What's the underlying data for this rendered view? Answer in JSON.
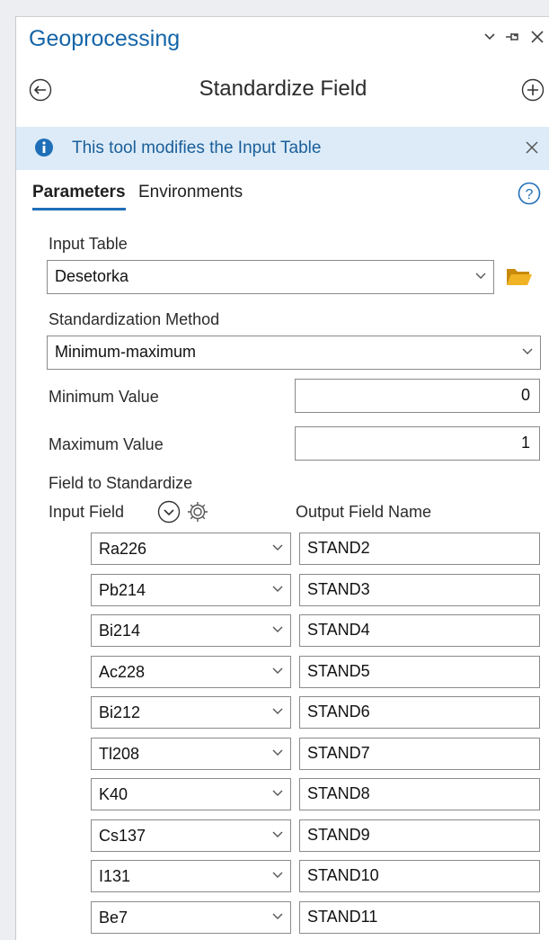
{
  "panel": {
    "title": "Geoprocessing",
    "tool_title": "Standardize Field",
    "info_message": "This tool modifies the Input Table",
    "tabs": [
      "Parameters",
      "Environments"
    ]
  },
  "params": {
    "input_table_label": "Input Table",
    "input_table_value": "Desetorka",
    "method_label": "Standardization Method",
    "method_value": "Minimum-maximum",
    "min_label": "Minimum Value",
    "min_value": "0",
    "max_label": "Maximum Value",
    "max_value": "1",
    "field_label": "Field to Standardize",
    "input_field_header": "Input Field",
    "output_field_header": "Output Field Name"
  },
  "rows": [
    {
      "input": "Ra226",
      "output": "STAND2"
    },
    {
      "input": "Pb214",
      "output": "STAND3"
    },
    {
      "input": "Bi214",
      "output": "STAND4"
    },
    {
      "input": "Ac228",
      "output": "STAND5"
    },
    {
      "input": "Bi212",
      "output": "STAND6"
    },
    {
      "input": "Tl208",
      "output": "STAND7"
    },
    {
      "input": "K40",
      "output": "STAND8"
    },
    {
      "input": "Cs137",
      "output": "STAND9"
    },
    {
      "input": "I131",
      "output": "STAND10"
    },
    {
      "input": "Be7",
      "output": "STAND11"
    }
  ],
  "colors": {
    "accent": "#1565a8",
    "info_bg": "#dcebf7",
    "folder": "#e6a817"
  }
}
